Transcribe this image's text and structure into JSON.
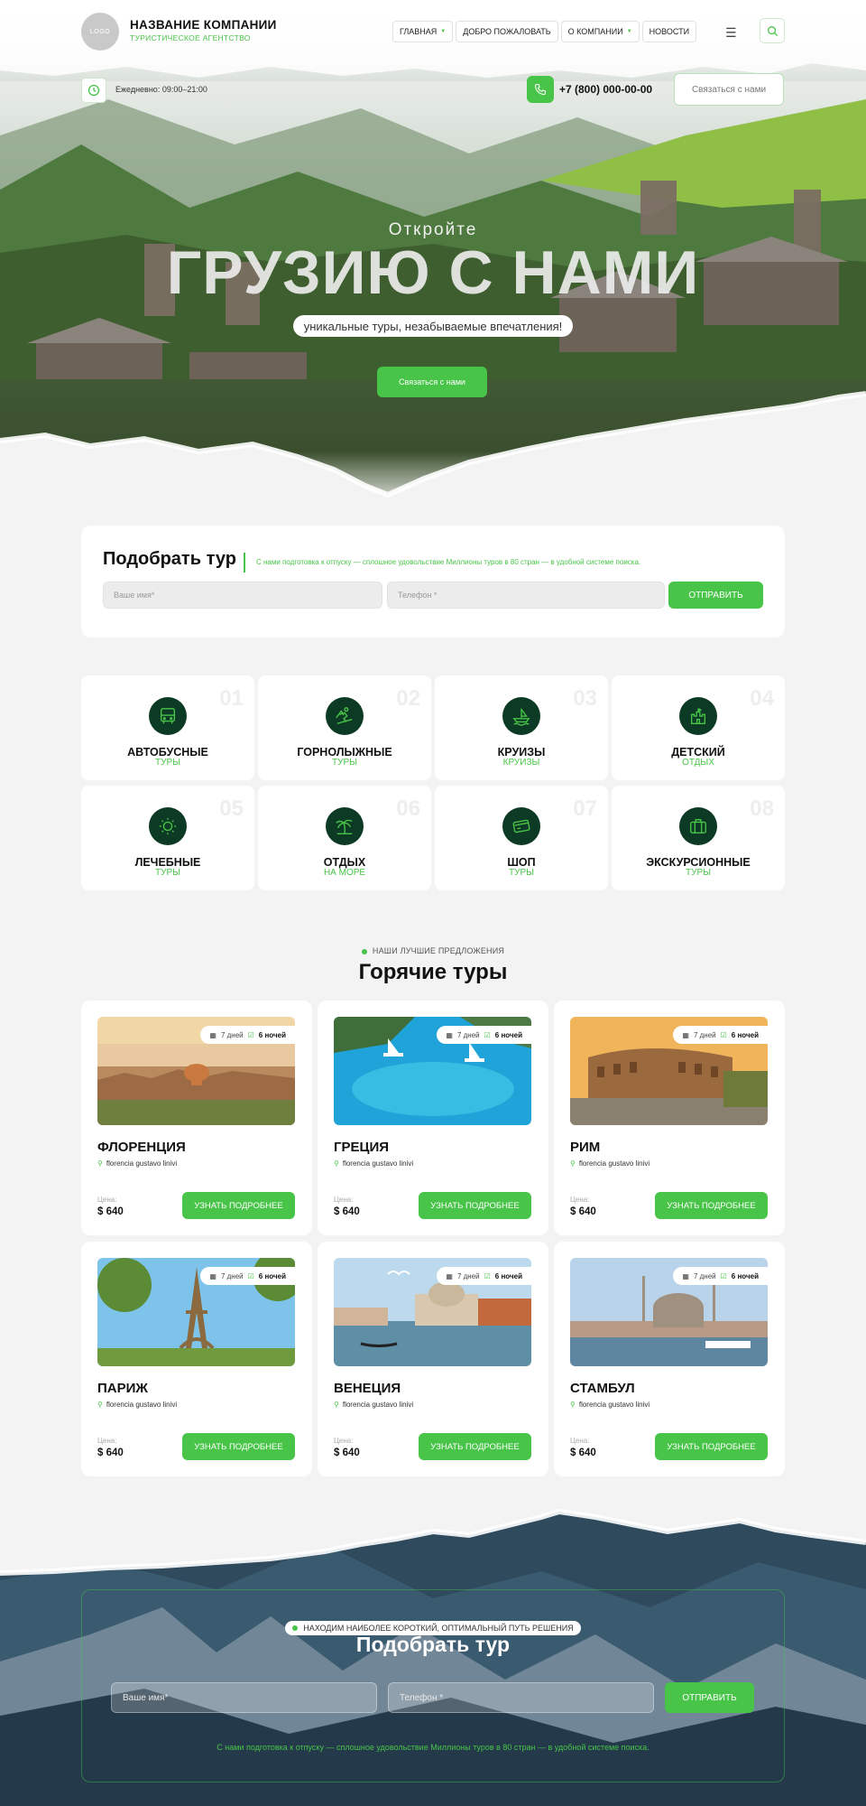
{
  "header": {
    "logo_text": "LOGO",
    "company_name": "НАЗВАНИЕ КОМПАНИИ",
    "company_subtitle": "ТУРИСТИЧЕСКОЕ АГЕНТСТВО",
    "nav": [
      {
        "label": "ГЛАВНАЯ",
        "has_dropdown": true
      },
      {
        "label": "ДОБРО ПОЖАЛОВАТЬ",
        "has_dropdown": false
      },
      {
        "label": "О КОМПАНИИ",
        "has_dropdown": true
      },
      {
        "label": "НОВОСТИ",
        "has_dropdown": false
      }
    ],
    "menu_icon": "hamburger-icon",
    "search_icon": "search-icon"
  },
  "subbar": {
    "hours": "Ежедневно: 09:00–21:00",
    "phone": "+7 (800) 000-00-00",
    "contact_label": "Связаться с нами"
  },
  "hero": {
    "supertitle": "Откройте",
    "title": "Грузию с нами",
    "tagline": "уникальные туры, незабываемые впечатления!",
    "cta": "Связаться с нами"
  },
  "quick_form": {
    "title": "Подобрать тур",
    "description": "С нами подготовка к отпуску — сплошное удовольствие Миллионы туров в 80 стран — в удобной системе поиска.",
    "name_placeholder": "Ваше имя*",
    "phone_placeholder": "Телефон *",
    "submit": "ОТПРАВИТЬ"
  },
  "categories": [
    {
      "num": "01",
      "title": "АВТОБУСНЫЕ",
      "sub": "ТУРЫ",
      "icon": "bus-icon"
    },
    {
      "num": "02",
      "title": "ГОРНОЛЫЖНЫЕ",
      "sub": "ТУРЫ",
      "icon": "skier-icon"
    },
    {
      "num": "03",
      "title": "КРУИЗЫ",
      "sub": "КРУИЗЫ",
      "icon": "ship-icon"
    },
    {
      "num": "04",
      "title": "ДЕТСКИЙ",
      "sub": "ОТДЫХ",
      "icon": "castle-icon"
    },
    {
      "num": "05",
      "title": "ЛЕЧЕБНЫЕ",
      "sub": "ТУРЫ",
      "icon": "sun-icon"
    },
    {
      "num": "06",
      "title": "ОТДЫХ",
      "sub": "НА МОРЕ",
      "icon": "palm-icon"
    },
    {
      "num": "07",
      "title": "ШОП",
      "sub": "ТУРЫ",
      "icon": "credit-card-icon"
    },
    {
      "num": "08",
      "title": "ЭКСКУРСИОННЫЕ",
      "sub": "ТУРЫ",
      "icon": "suitcase-icon"
    }
  ],
  "hot": {
    "eyebrow": "НАШИ ЛУЧШИЕ ПРЕДЛОЖЕНИЯ",
    "title": "Горячие туры",
    "days_label": "7 дней",
    "nights_label": "6 ночей",
    "price_label": "Цена:",
    "button_label": "УЗНАТЬ ПОДРОБНЕЕ",
    "tours": [
      {
        "name": "ФЛОРЕНЦИЯ",
        "location": "florencia gustavo linivi",
        "price": "$ 640",
        "scene": "florence"
      },
      {
        "name": "ГРЕЦИЯ",
        "location": "florencia gustavo linivi",
        "price": "$ 640",
        "scene": "greece"
      },
      {
        "name": "РИМ",
        "location": "florencia gustavo linivi",
        "price": "$ 640",
        "scene": "rome"
      },
      {
        "name": "ПАРИЖ",
        "location": "florencia gustavo linivi",
        "price": "$ 640",
        "scene": "paris"
      },
      {
        "name": "ВЕНЕЦИЯ",
        "location": "florencia gustavo linivi",
        "price": "$ 640",
        "scene": "venice"
      },
      {
        "name": "СТАМБУЛ",
        "location": "florencia gustavo linivi",
        "price": "$ 640",
        "scene": "istanbul"
      }
    ]
  },
  "bottom_form": {
    "eyebrow": "НАХОДИМ НАИБОЛЕЕ КОРОТКИЙ, ОПТИМАЛЬНЫЙ ПУТЬ РЕШЕНИЯ",
    "title": "Подобрать тур",
    "name_placeholder": "Ваше имя*",
    "phone_placeholder": "Телефон *",
    "submit": "ОТПРАВИТЬ",
    "description": "С нами подготовка к отпуску — сплошное удовольствие Миллионы туров в 80 стран — в удобной системе поиска."
  },
  "colors": {
    "accent": "#48c448",
    "icon_bg": "#0d3a25",
    "page_bg": "#f3f3f3"
  }
}
